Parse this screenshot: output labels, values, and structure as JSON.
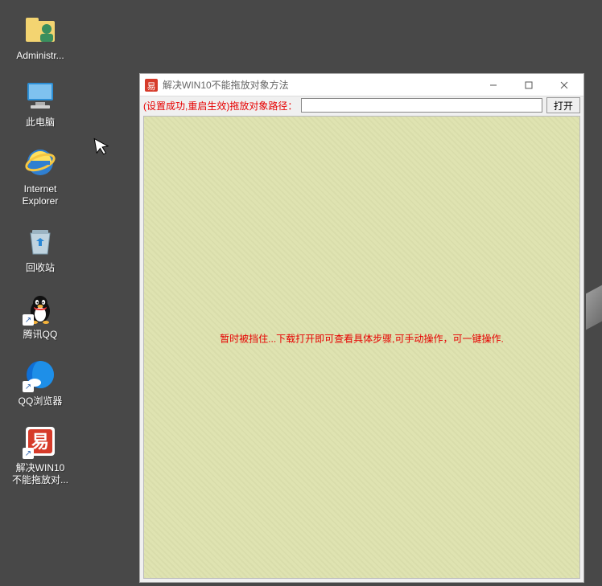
{
  "desktop": {
    "icons": [
      {
        "id": "administrator",
        "label": "Administr...",
        "kind": "user",
        "shortcut": false
      },
      {
        "id": "this-pc",
        "label": "此电脑",
        "kind": "pc",
        "shortcut": false
      },
      {
        "id": "ie",
        "label": "Internet\nExplorer",
        "kind": "ie",
        "shortcut": false
      },
      {
        "id": "recycle",
        "label": "回收站",
        "kind": "recycle",
        "shortcut": false
      },
      {
        "id": "qq",
        "label": "腾讯QQ",
        "kind": "qq",
        "shortcut": true
      },
      {
        "id": "qqbrowser",
        "label": "QQ浏览器",
        "kind": "qqbrowser",
        "shortcut": true
      },
      {
        "id": "win10fix",
        "label": "解决WIN10\n不能拖放对...",
        "kind": "efile",
        "shortcut": true
      }
    ]
  },
  "window": {
    "title": "解决WIN10不能拖放对象方法",
    "toolbar": {
      "note": "(设置成功,重启生效)拖放对象路径：",
      "path_value": "",
      "open_label": "打开"
    },
    "content": {
      "blocked_message": "暂时被挡住...下载打开即可查看具体步骤,可手动操作，可一键操作."
    }
  }
}
